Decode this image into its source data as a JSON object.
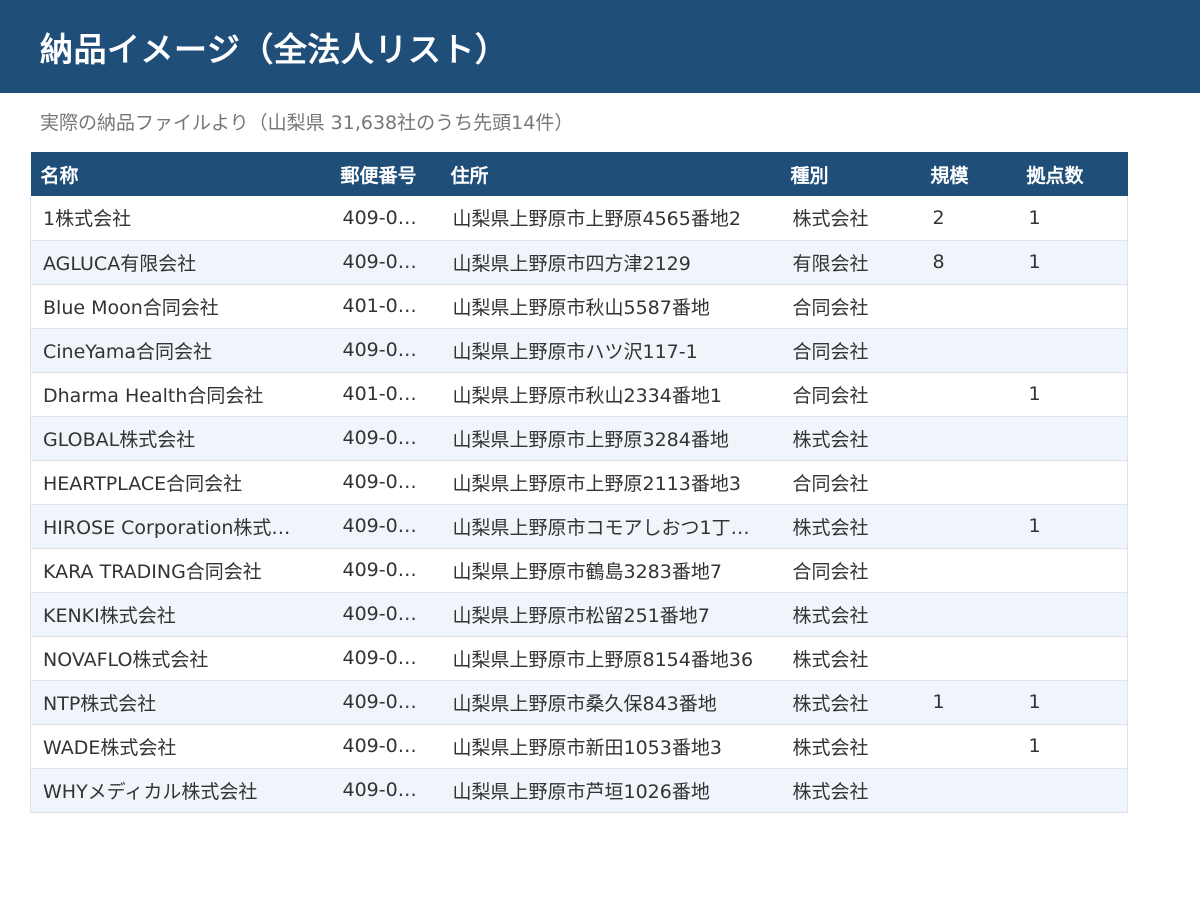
{
  "header": {
    "title": "納品イメージ（全法人リスト）",
    "subtitle": "実際の納品ファイルより（山梨県 31,638社のうち先頭14件）"
  },
  "table": {
    "columns": [
      "名称",
      "郵便番号",
      "住所",
      "種別",
      "規模",
      "拠点数"
    ],
    "rows": [
      [
        "1株式会社",
        "409-0…",
        "山梨県上野原市上野原4565番地2",
        "株式会社",
        "2",
        "1"
      ],
      [
        "AGLUCA有限会社",
        "409-0…",
        "山梨県上野原市四方津2129",
        "有限会社",
        "8",
        "1"
      ],
      [
        "Blue Moon合同会社",
        "401-0…",
        "山梨県上野原市秋山5587番地",
        "合同会社",
        "",
        ""
      ],
      [
        "CineYama合同会社",
        "409-0…",
        "山梨県上野原市ハツ沢117-1",
        "合同会社",
        "",
        ""
      ],
      [
        "Dharma Health合同会社",
        "401-0…",
        "山梨県上野原市秋山2334番地1",
        "合同会社",
        "",
        "1"
      ],
      [
        "GLOBAL株式会社",
        "409-0…",
        "山梨県上野原市上野原3284番地",
        "株式会社",
        "",
        ""
      ],
      [
        "HEARTPLACE合同会社",
        "409-0…",
        "山梨県上野原市上野原2113番地3",
        "合同会社",
        "",
        ""
      ],
      [
        "HIROSE Corporation株式…",
        "409-0…",
        "山梨県上野原市コモアしおつ1丁…",
        "株式会社",
        "",
        "1"
      ],
      [
        "KARA TRADING合同会社",
        "409-0…",
        "山梨県上野原市鶴島3283番地7",
        "合同会社",
        "",
        ""
      ],
      [
        "KENKI株式会社",
        "409-0…",
        "山梨県上野原市松留251番地7",
        "株式会社",
        "",
        ""
      ],
      [
        "NOVAFLO株式会社",
        "409-0…",
        "山梨県上野原市上野原8154番地36",
        "株式会社",
        "",
        ""
      ],
      [
        "NTP株式会社",
        "409-0…",
        "山梨県上野原市桑久保843番地",
        "株式会社",
        "1",
        "1"
      ],
      [
        "WADE株式会社",
        "409-0…",
        "山梨県上野原市新田1053番地3",
        "株式会社",
        "",
        "1"
      ],
      [
        "WHYメディカル株式会社",
        "409-0…",
        "山梨県上野原市芦垣1026番地",
        "株式会社",
        "",
        ""
      ]
    ]
  },
  "colors": {
    "header_bg": "#1f4e79",
    "row_alt_bg": "#f0f5fb"
  }
}
